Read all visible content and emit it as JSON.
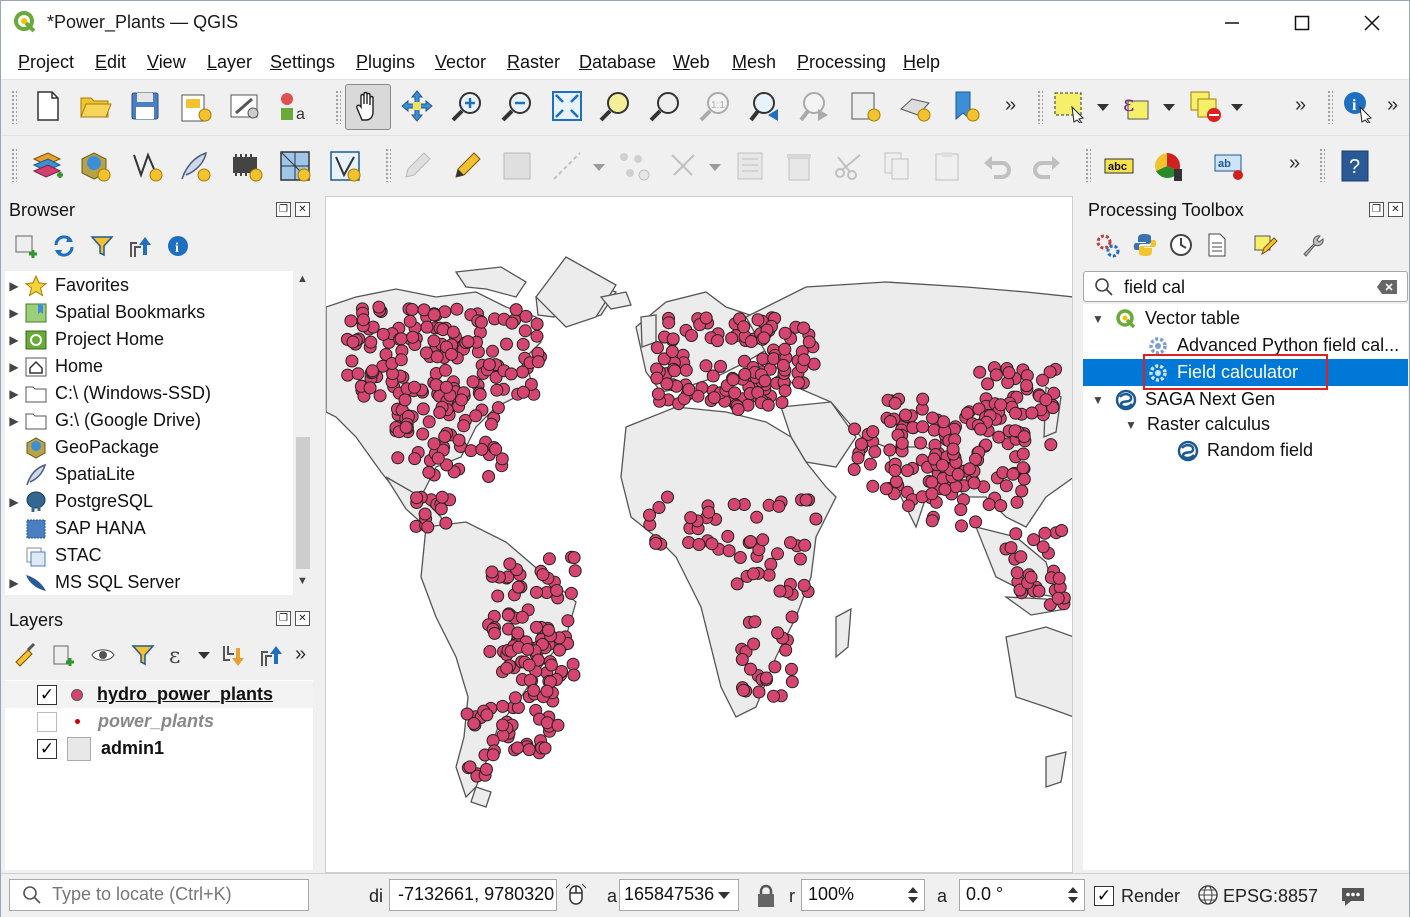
{
  "window": {
    "title": "*Power_Plants — QGIS"
  },
  "menu": [
    {
      "label": "Project"
    },
    {
      "label": "Edit"
    },
    {
      "label": "View"
    },
    {
      "label": "Layer"
    },
    {
      "label": "Settings"
    },
    {
      "label": "Plugins"
    },
    {
      "label": "Vector"
    },
    {
      "label": "Raster"
    },
    {
      "label": "Database"
    },
    {
      "label": "Web"
    },
    {
      "label": "Mesh"
    },
    {
      "label": "Processing"
    },
    {
      "label": "Help"
    }
  ],
  "browser": {
    "title": "Browser",
    "items": [
      {
        "label": "Favorites",
        "icon": "star-icon"
      },
      {
        "label": "Spatial Bookmarks",
        "icon": "bookmark-icon"
      },
      {
        "label": "Project Home",
        "icon": "project-home-icon"
      },
      {
        "label": "Home",
        "icon": "home-icon"
      },
      {
        "label": "C:\\ (Windows-SSD)",
        "icon": "folder-icon"
      },
      {
        "label": "G:\\ (Google Drive)",
        "icon": "folder-icon"
      },
      {
        "label": "GeoPackage",
        "icon": "geopackage-icon"
      },
      {
        "label": "SpatiaLite",
        "icon": "spatialite-icon"
      },
      {
        "label": "PostgreSQL",
        "icon": "postgresql-icon"
      },
      {
        "label": "SAP HANA",
        "icon": "sap-hana-icon"
      },
      {
        "label": "STAC",
        "icon": "stac-icon"
      },
      {
        "label": "MS SQL Server",
        "icon": "mssql-icon"
      }
    ]
  },
  "layers": {
    "title": "Layers",
    "items": [
      {
        "label": "hydro_power_plants",
        "checked": true,
        "color": "#d6456f"
      },
      {
        "label": "power_plants",
        "checked": false,
        "color": "#cc0000"
      },
      {
        "label": "admin1",
        "checked": true,
        "color": "#e8e8e8"
      }
    ]
  },
  "toolbox": {
    "title": "Processing Toolbox",
    "search_value": "field cal",
    "items": [
      {
        "label": "Vector table"
      },
      {
        "label": "Advanced Python field cal..."
      },
      {
        "label": "Field calculator"
      },
      {
        "label": "SAGA Next Gen"
      },
      {
        "label": "Raster calculus"
      },
      {
        "label": "Random field"
      }
    ]
  },
  "statusbar": {
    "locate_placeholder": "Type to locate (Ctrl+K)",
    "coord_label": "di",
    "coordinate": "-7132661, 9780320",
    "scale_label": "a",
    "scale": "165847536",
    "magnifier_label": "r",
    "magnifier": "100%",
    "rotation_label": "a",
    "rotation": "0.0 °",
    "render_label": "Render",
    "crs": "EPSG:8857"
  },
  "colors": {
    "point_fill": "#d6456f",
    "land_fill": "#ececec",
    "selection": "#0078d7",
    "highlight_box": "#e02020"
  }
}
